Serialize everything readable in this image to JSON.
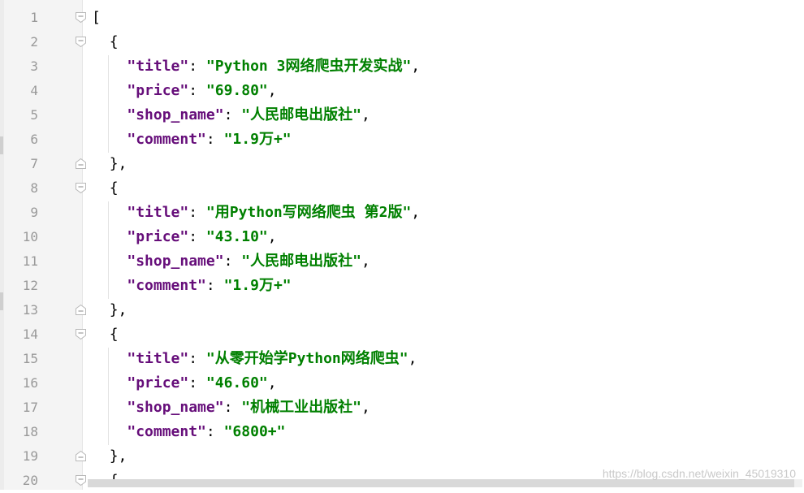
{
  "editor": {
    "lines": [
      {
        "no": "1",
        "indent": "",
        "segments": [
          {
            "t": "[",
            "c": "p"
          }
        ]
      },
      {
        "no": "2",
        "indent": "  ",
        "segments": [
          {
            "t": "{",
            "c": "p"
          }
        ]
      },
      {
        "no": "3",
        "indent": "    ",
        "segments": [
          {
            "t": "\"title\"",
            "c": "k"
          },
          {
            "t": ": ",
            "c": "p"
          },
          {
            "t": "\"Python 3网络爬虫开发实战\"",
            "c": "s"
          },
          {
            "t": ",",
            "c": "p"
          }
        ]
      },
      {
        "no": "4",
        "indent": "    ",
        "segments": [
          {
            "t": "\"price\"",
            "c": "k"
          },
          {
            "t": ": ",
            "c": "p"
          },
          {
            "t": "\"69.80\"",
            "c": "s"
          },
          {
            "t": ",",
            "c": "p"
          }
        ]
      },
      {
        "no": "5",
        "indent": "    ",
        "segments": [
          {
            "t": "\"shop_name\"",
            "c": "k"
          },
          {
            "t": ": ",
            "c": "p"
          },
          {
            "t": "\"人民邮电出版社\"",
            "c": "s"
          },
          {
            "t": ",",
            "c": "p"
          }
        ]
      },
      {
        "no": "6",
        "indent": "    ",
        "segments": [
          {
            "t": "\"comment\"",
            "c": "k"
          },
          {
            "t": ": ",
            "c": "p"
          },
          {
            "t": "\"1.9万+\"",
            "c": "s"
          }
        ]
      },
      {
        "no": "7",
        "indent": "  ",
        "segments": [
          {
            "t": "},",
            "c": "p"
          }
        ]
      },
      {
        "no": "8",
        "indent": "  ",
        "segments": [
          {
            "t": "{",
            "c": "p"
          }
        ]
      },
      {
        "no": "9",
        "indent": "    ",
        "segments": [
          {
            "t": "\"title\"",
            "c": "k"
          },
          {
            "t": ": ",
            "c": "p"
          },
          {
            "t": "\"用Python写网络爬虫 第2版\"",
            "c": "s"
          },
          {
            "t": ",",
            "c": "p"
          }
        ]
      },
      {
        "no": "10",
        "indent": "    ",
        "segments": [
          {
            "t": "\"price\"",
            "c": "k"
          },
          {
            "t": ": ",
            "c": "p"
          },
          {
            "t": "\"43.10\"",
            "c": "s"
          },
          {
            "t": ",",
            "c": "p"
          }
        ]
      },
      {
        "no": "11",
        "indent": "    ",
        "segments": [
          {
            "t": "\"shop_name\"",
            "c": "k"
          },
          {
            "t": ": ",
            "c": "p"
          },
          {
            "t": "\"人民邮电出版社\"",
            "c": "s"
          },
          {
            "t": ",",
            "c": "p"
          }
        ]
      },
      {
        "no": "12",
        "indent": "    ",
        "segments": [
          {
            "t": "\"comment\"",
            "c": "k"
          },
          {
            "t": ": ",
            "c": "p"
          },
          {
            "t": "\"1.9万+\"",
            "c": "s"
          }
        ]
      },
      {
        "no": "13",
        "indent": "  ",
        "segments": [
          {
            "t": "},",
            "c": "p"
          }
        ]
      },
      {
        "no": "14",
        "indent": "  ",
        "segments": [
          {
            "t": "{",
            "c": "p"
          }
        ]
      },
      {
        "no": "15",
        "indent": "    ",
        "segments": [
          {
            "t": "\"title\"",
            "c": "k"
          },
          {
            "t": ": ",
            "c": "p"
          },
          {
            "t": "\"从零开始学Python网络爬虫\"",
            "c": "s"
          },
          {
            "t": ",",
            "c": "p"
          }
        ]
      },
      {
        "no": "16",
        "indent": "    ",
        "segments": [
          {
            "t": "\"price\"",
            "c": "k"
          },
          {
            "t": ": ",
            "c": "p"
          },
          {
            "t": "\"46.60\"",
            "c": "s"
          },
          {
            "t": ",",
            "c": "p"
          }
        ]
      },
      {
        "no": "17",
        "indent": "    ",
        "segments": [
          {
            "t": "\"shop_name\"",
            "c": "k"
          },
          {
            "t": ": ",
            "c": "p"
          },
          {
            "t": "\"机械工业出版社\"",
            "c": "s"
          },
          {
            "t": ",",
            "c": "p"
          }
        ]
      },
      {
        "no": "18",
        "indent": "    ",
        "segments": [
          {
            "t": "\"comment\"",
            "c": "k"
          },
          {
            "t": ": ",
            "c": "p"
          },
          {
            "t": "\"6800+\"",
            "c": "s"
          }
        ]
      },
      {
        "no": "19",
        "indent": "  ",
        "segments": [
          {
            "t": "},",
            "c": "p"
          }
        ]
      },
      {
        "no": "20",
        "indent": "  ",
        "segments": [
          {
            "t": "{",
            "c": "p"
          }
        ]
      }
    ],
    "fold_markers": {
      "1": "open",
      "2": "open",
      "7": "close",
      "8": "open",
      "13": "close",
      "14": "open",
      "19": "close",
      "20": "open"
    }
  },
  "watermark": "https://blog.csdn.net/weixin_45019310",
  "colors": {
    "key": "#660e7a",
    "string": "#008000",
    "line_number": "#999999",
    "gutter": "#f4f4f4"
  }
}
